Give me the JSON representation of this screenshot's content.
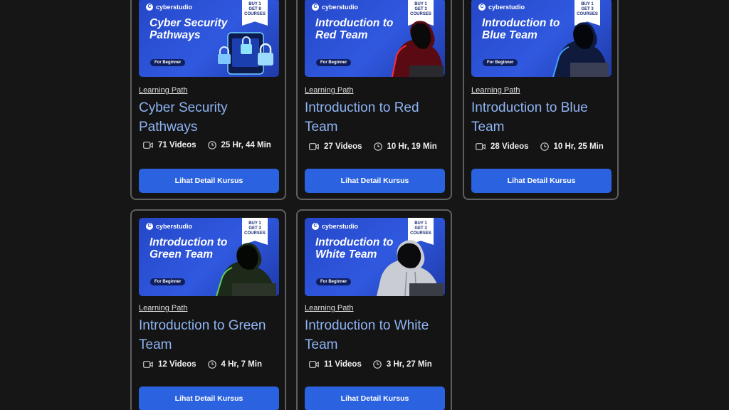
{
  "courses": [
    {
      "brand": "cyberstudio",
      "promo_1": "BUY 1",
      "promo_2": "GET 8",
      "promo_3": "COURSES",
      "thumb_title": "Cyber Security Pathways",
      "level": "For Beginner",
      "tag": "Learning Path",
      "title": "Cyber Security Pathways",
      "videos": "71 Videos",
      "duration": "25 Hr, 44 Min",
      "button": "Lihat Detail Kursus"
    },
    {
      "brand": "cyberstudio",
      "promo_1": "BUY 1",
      "promo_2": "GET 3",
      "promo_3": "COURSES",
      "thumb_title": "Introduction to Red Team",
      "level": "For Beginner",
      "tag": "Learning Path",
      "title": "Introduction to Red Team",
      "videos": "27 Videos",
      "duration": "10 Hr, 19 Min",
      "button": "Lihat Detail Kursus"
    },
    {
      "brand": "cyberstudio",
      "promo_1": "BUY 1",
      "promo_2": "GET 3",
      "promo_3": "COURSES",
      "thumb_title": "Introduction to Blue Team",
      "level": "For Beginner",
      "tag": "Learning Path",
      "title": "Introduction to Blue Team",
      "videos": "28 Videos",
      "duration": "10 Hr, 25 Min",
      "button": "Lihat Detail Kursus"
    },
    {
      "brand": "cyberstudio",
      "promo_1": "BUY 1",
      "promo_2": "GET 3",
      "promo_3": "COURSES",
      "thumb_title": "Introduction to Green Team",
      "level": "For Beginner",
      "tag": "Learning Path",
      "title": "Introduction to Green Team",
      "videos": "12 Videos",
      "duration": "4 Hr, 7 Min",
      "button": "Lihat Detail Kursus"
    },
    {
      "brand": "cyberstudio",
      "promo_1": "BUY 1",
      "promo_2": "GET 3",
      "promo_3": "COURSES",
      "thumb_title": "Introduction to White Team",
      "level": "For Beginner",
      "tag": "Learning Path",
      "title": "Introduction to White Team",
      "videos": "11 Videos",
      "duration": "3 Hr, 27 Min",
      "button": "Lihat Detail Kursus"
    }
  ],
  "colors": {
    "page_bg": "#161616",
    "card_border": "#5f5f5f",
    "title_blue": "#8fb4f4",
    "button_blue": "#2a62df",
    "thumb_blue": "#3059e0"
  },
  "icons": {
    "video": "video-camera-icon",
    "duration": "clock-icon",
    "brand": "cyberstudio-logo"
  }
}
